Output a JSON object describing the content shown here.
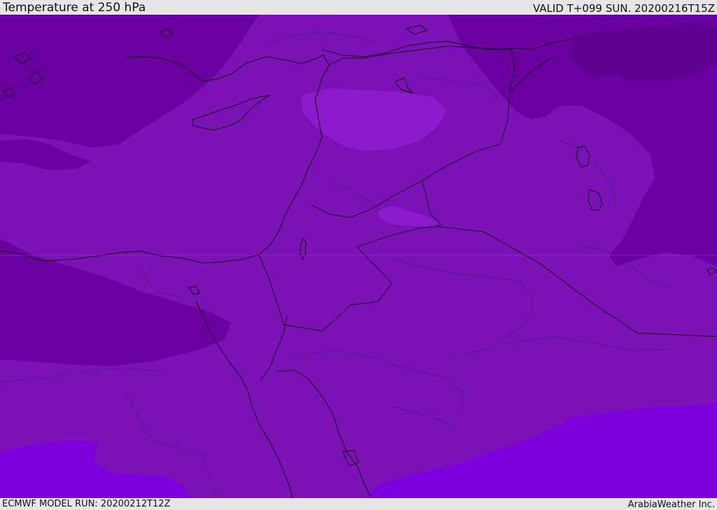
{
  "header": {
    "title": "Temperature at 250 hPa",
    "valid_time": "VALID T+099 SUN. 20200216T15Z"
  },
  "footer": {
    "model_run": "ECMWF MODEL RUN: 20200212T12Z",
    "credit": "ArabiaWeather Inc."
  },
  "map": {
    "region": "Eastern Mediterranean and Middle East",
    "field": "Temperature at 250 hPa",
    "fill_colors": {
      "coldest": "#5e0090",
      "cold": "#6a00a0",
      "mid": "#7a12b6",
      "warm": "#8a1ccc",
      "warmest": "#7d00dd"
    },
    "coastline_color": "#111111",
    "border_color": "#111111"
  }
}
